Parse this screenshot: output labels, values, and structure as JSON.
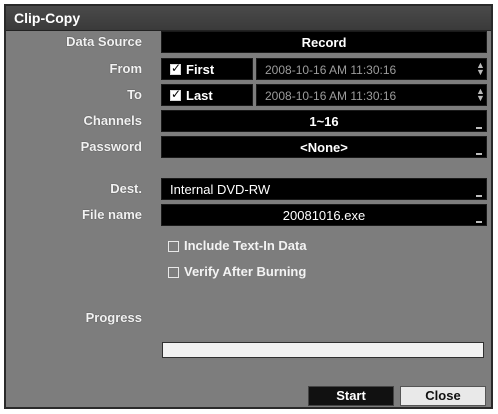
{
  "dialog": {
    "title": "Clip-Copy"
  },
  "labels": {
    "data_source": "Data Source",
    "from": "From",
    "to": "To",
    "channels": "Channels",
    "password": "Password",
    "dest": "Dest.",
    "file_name": "File name",
    "progress": "Progress"
  },
  "fields": {
    "data_source": "Record",
    "from_check_label": "First",
    "from_datetime": "2008-10-16   AM 11:30:16",
    "to_check_label": "Last",
    "to_datetime": "2008-10-16   AM 11:30:16",
    "channels": "1~16",
    "password": "<None>",
    "dest": "Internal DVD-RW",
    "file_name": "20081016.exe"
  },
  "options": {
    "include_text_in": "Include Text-In Data",
    "verify_after_burning": "Verify After Burning"
  },
  "progress": {
    "value": 0
  },
  "buttons": {
    "start": "Start",
    "close": "Close"
  },
  "colors": {
    "dialog_bg": "#7d7d7d",
    "field_bg": "#000000",
    "title_bg": "#3f3f3f"
  }
}
